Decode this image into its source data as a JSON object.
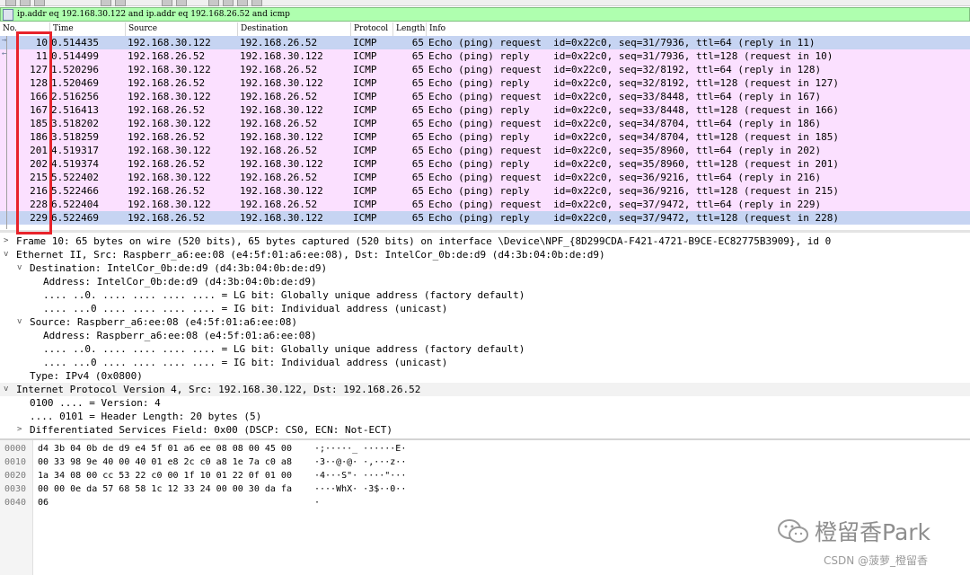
{
  "filter": {
    "value": "ip.addr eq 192.168.30.122 and ip.addr eq 192.168.26.52 and icmp"
  },
  "packet_list": {
    "columns": [
      "No.",
      "Time",
      "Source",
      "Destination",
      "Protocol",
      "Length",
      "Info"
    ],
    "rows": [
      [
        "10",
        "0.514435",
        "192.168.30.122",
        "192.168.26.52",
        "ICMP",
        "65",
        "Echo (ping) request  id=0x22c0, seq=31/7936, ttl=64 (reply in 11)"
      ],
      [
        "11",
        "0.514499",
        "192.168.26.52",
        "192.168.30.122",
        "ICMP",
        "65",
        "Echo (ping) reply    id=0x22c0, seq=31/7936, ttl=128 (request in 10)"
      ],
      [
        "127",
        "1.520296",
        "192.168.30.122",
        "192.168.26.52",
        "ICMP",
        "65",
        "Echo (ping) request  id=0x22c0, seq=32/8192, ttl=64 (reply in 128)"
      ],
      [
        "128",
        "1.520469",
        "192.168.26.52",
        "192.168.30.122",
        "ICMP",
        "65",
        "Echo (ping) reply    id=0x22c0, seq=32/8192, ttl=128 (request in 127)"
      ],
      [
        "166",
        "2.516256",
        "192.168.30.122",
        "192.168.26.52",
        "ICMP",
        "65",
        "Echo (ping) request  id=0x22c0, seq=33/8448, ttl=64 (reply in 167)"
      ],
      [
        "167",
        "2.516413",
        "192.168.26.52",
        "192.168.30.122",
        "ICMP",
        "65",
        "Echo (ping) reply    id=0x22c0, seq=33/8448, ttl=128 (request in 166)"
      ],
      [
        "185",
        "3.518202",
        "192.168.30.122",
        "192.168.26.52",
        "ICMP",
        "65",
        "Echo (ping) request  id=0x22c0, seq=34/8704, ttl=64 (reply in 186)"
      ],
      [
        "186",
        "3.518259",
        "192.168.26.52",
        "192.168.30.122",
        "ICMP",
        "65",
        "Echo (ping) reply    id=0x22c0, seq=34/8704, ttl=128 (request in 185)"
      ],
      [
        "201",
        "4.519317",
        "192.168.30.122",
        "192.168.26.52",
        "ICMP",
        "65",
        "Echo (ping) request  id=0x22c0, seq=35/8960, ttl=64 (reply in 202)"
      ],
      [
        "202",
        "4.519374",
        "192.168.26.52",
        "192.168.30.122",
        "ICMP",
        "65",
        "Echo (ping) reply    id=0x22c0, seq=35/8960, ttl=128 (request in 201)"
      ],
      [
        "215",
        "5.522402",
        "192.168.30.122",
        "192.168.26.52",
        "ICMP",
        "65",
        "Echo (ping) request  id=0x22c0, seq=36/9216, ttl=64 (reply in 216)"
      ],
      [
        "216",
        "5.522466",
        "192.168.26.52",
        "192.168.30.122",
        "ICMP",
        "65",
        "Echo (ping) reply    id=0x22c0, seq=36/9216, ttl=128 (request in 215)"
      ],
      [
        "228",
        "6.522404",
        "192.168.30.122",
        "192.168.26.52",
        "ICMP",
        "65",
        "Echo (ping) request  id=0x22c0, seq=37/9472, ttl=64 (reply in 229)"
      ],
      [
        "229",
        "6.522469",
        "192.168.26.52",
        "192.168.30.122",
        "ICMP",
        "65",
        "Echo (ping) reply    id=0x22c0, seq=37/9472, ttl=128 (request in 228)"
      ]
    ]
  },
  "details": {
    "lines": [
      "Frame 10: 65 bytes on wire (520 bits), 65 bytes captured (520 bits) on interface \\Device\\NPF_{8D299CDA-F421-4721-B9CE-EC82775B3909}, id 0",
      "Ethernet II, Src: Raspberr_a6:ee:08 (e4:5f:01:a6:ee:08), Dst: IntelCor_0b:de:d9 (d4:3b:04:0b:de:d9)",
      "Destination: IntelCor_0b:de:d9 (d4:3b:04:0b:de:d9)",
      "Address: IntelCor_0b:de:d9 (d4:3b:04:0b:de:d9)",
      ".... ..0. .... .... .... .... = LG bit: Globally unique address (factory default)",
      ".... ...0 .... .... .... .... = IG bit: Individual address (unicast)",
      "Source: Raspberr_a6:ee:08 (e4:5f:01:a6:ee:08)",
      "Address: Raspberr_a6:ee:08 (e4:5f:01:a6:ee:08)",
      ".... ..0. .... .... .... .... = LG bit: Globally unique address (factory default)",
      ".... ...0 .... .... .... .... = IG bit: Individual address (unicast)",
      "Type: IPv4 (0x0800)",
      "Internet Protocol Version 4, Src: 192.168.30.122, Dst: 192.168.26.52",
      "0100 .... = Version: 4",
      ".... 0101 = Header Length: 20 bytes (5)",
      "Differentiated Services Field: 0x00 (DSCP: CS0, ECN: Not-ECT)"
    ]
  },
  "bytes": {
    "lines": [
      {
        "off": "0000",
        "hex": "d4 3b 04 0b de d9 e4 5f  01 a6 ee 08 08 00 45 00",
        "ascii": "·;·····_ ······E·"
      },
      {
        "off": "0010",
        "hex": "00 33 98 9e 40 00 40 01  e8 2c c0 a8 1e 7a c0 a8",
        "ascii": "·3··@·@· ·,···z··"
      },
      {
        "off": "0020",
        "hex": "1a 34 08 00 cc 53 22 c0  00 1f 10 01 22 0f 01 00",
        "ascii": "·4···S\"· ····\"···"
      },
      {
        "off": "0030",
        "hex": "00 00 0e da 57 68 58 1c  12 33 24 00 00 30 da fa",
        "ascii": "····WhX· ·3$··0··"
      },
      {
        "off": "0040",
        "hex": "06",
        "ascii": "·"
      }
    ]
  },
  "watermark": {
    "brand": "橙留香Park",
    "credit": "CSDN @菠萝_橙留香"
  }
}
